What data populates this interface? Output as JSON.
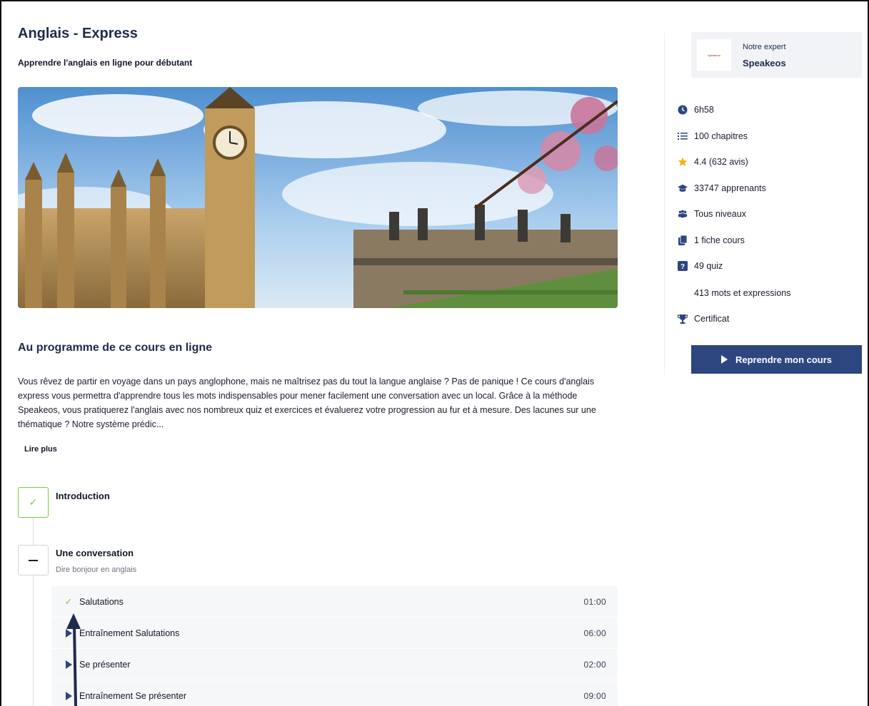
{
  "course": {
    "title": "Anglais - Express",
    "subtitle": "Apprendre l'anglais en ligne pour débutant"
  },
  "program": {
    "title": "Au programme de ce cours en ligne",
    "description": "Vous rêvez de partir en voyage dans un pays anglophone, mais ne maîtrisez pas du tout la langue anglaise ? Pas de panique ! Ce cours d'anglais express vous permettra d'apprendre tous les mots indispensables pour mener facilement une conversation avec un local. Grâce à la méthode Speakeos, vous pratiquerez l'anglais avec nos nombreux quiz et exercices et évaluerez votre progression au fur et à mesure. Des lacunes sur une thématique ? Notre système prédic...",
    "read_more": "Lire plus"
  },
  "chapters": [
    {
      "title": "Introduction",
      "status": "completed",
      "icon": "check-icon"
    },
    {
      "title": "Une conversation",
      "subtitle": "Dire bonjour en anglais",
      "status": "expanded",
      "icon": "minus-icon"
    }
  ],
  "lessons": [
    {
      "label": "Salutations",
      "duration": "01:00",
      "icon": "check-icon"
    },
    {
      "label": "Entraînement Salutations",
      "duration": "06:00",
      "icon": "play-icon"
    },
    {
      "label": "Se présenter",
      "duration": "02:00",
      "icon": "play-icon"
    },
    {
      "label": "Entraînement Se présenter",
      "duration": "09:00",
      "icon": "play-icon"
    }
  ],
  "expert": {
    "label": "Notre expert",
    "name": "Speakeos",
    "logo_text": "Speakeos"
  },
  "stats": [
    {
      "icon": "clock-icon",
      "text": "6h58"
    },
    {
      "icon": "list-icon",
      "text": "100 chapitres"
    },
    {
      "icon": "star-icon",
      "text": "4.4 (632 avis)"
    },
    {
      "icon": "graduation-cap-icon",
      "text": "33747 apprenants"
    },
    {
      "icon": "users-icon",
      "text": "Tous niveaux"
    },
    {
      "icon": "document-icon",
      "text": "1 fiche cours"
    },
    {
      "icon": "question-icon",
      "text": "49 quiz"
    },
    {
      "icon": "",
      "text": "413 mots et expressions"
    },
    {
      "icon": "trophy-icon",
      "text": "Certificat"
    }
  ],
  "actions": {
    "resume_label": "Reprendre mon cours"
  },
  "colors": {
    "primary": "#2d4680",
    "success": "#7ac943",
    "star": "#f5b316",
    "title": "#1f2b4d"
  }
}
